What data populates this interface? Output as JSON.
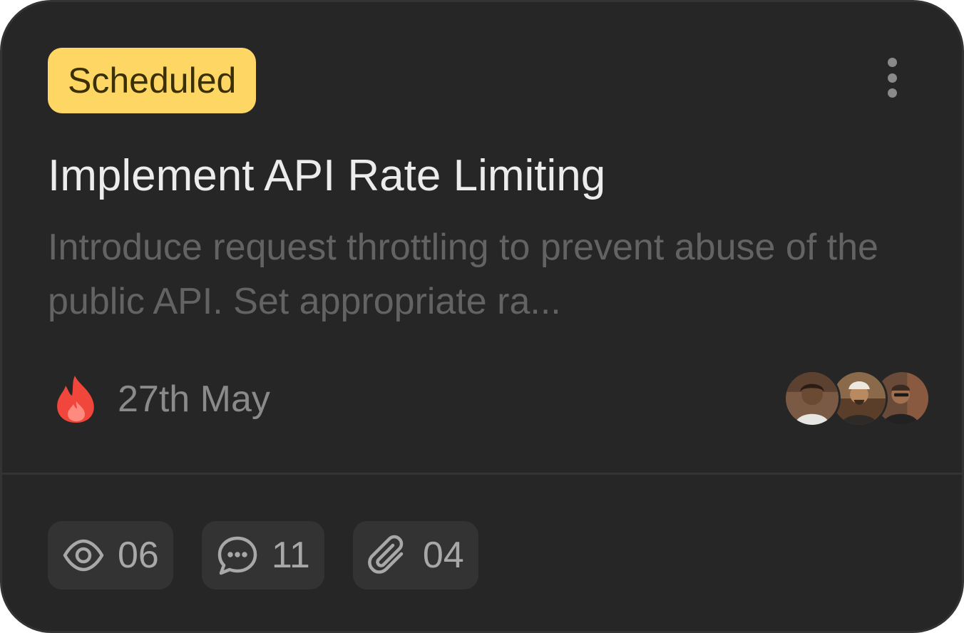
{
  "card": {
    "status": "Scheduled",
    "title": "Implement API Rate Limiting",
    "description": "Introduce request throttling to prevent abuse of the public API. Set appropriate ra...",
    "due_icon": "fire-icon",
    "due_date": "27th May",
    "assignees": [
      {
        "icon": "avatar"
      },
      {
        "icon": "avatar"
      },
      {
        "icon": "avatar"
      }
    ],
    "stats": {
      "views": {
        "icon": "eye-icon",
        "count": "06"
      },
      "comments": {
        "icon": "comment-icon",
        "count": "11"
      },
      "attachments": {
        "icon": "paperclip-icon",
        "count": "04"
      }
    }
  },
  "colors": {
    "card_background": "#262626",
    "badge_background": "#fdd663",
    "badge_text": "#3a2f05",
    "title_text": "#ececec",
    "description_text": "#636363",
    "fire_red": "#f0463c"
  }
}
